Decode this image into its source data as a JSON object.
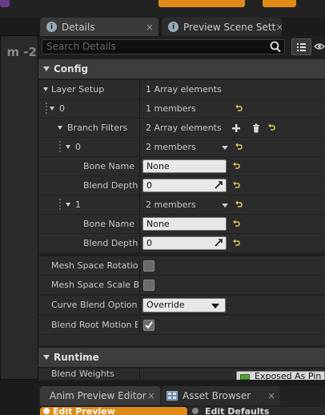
{
  "viewport_label": "m -2",
  "tabs": [
    {
      "label": "Details",
      "close": "×"
    },
    {
      "label": "Preview Scene Sett",
      "close": "×"
    }
  ],
  "search": {
    "placeholder": "Search Details"
  },
  "categories": {
    "config": "Config",
    "runtime": "Runtime"
  },
  "rows": {
    "layer_setup": {
      "label": "Layer Setup",
      "value": "1 Array elements"
    },
    "index0": {
      "label": "0",
      "value": "1 members"
    },
    "branch_filters": {
      "label": "Branch Filters",
      "value": "2 Array elements"
    },
    "bf0": {
      "label": "0",
      "value": "2 members"
    },
    "bf0_bone": {
      "label": "Bone Name",
      "value": "None"
    },
    "bf0_depth": {
      "label": "Blend Depth",
      "value": "0"
    },
    "bf1": {
      "label": "1",
      "value": "2 members"
    },
    "bf1_bone": {
      "label": "Bone Name",
      "value": "None"
    },
    "bf1_depth": {
      "label": "Blend Depth",
      "value": "0"
    },
    "mesh_rot": {
      "label": "Mesh Space Rotation"
    },
    "mesh_scale": {
      "label": "Mesh Space Scale Ble"
    },
    "curve_blend": {
      "label": "Curve Blend Option",
      "value": "Override"
    },
    "root_motion": {
      "label": "Blend Root Motion Ba"
    },
    "blend_weights": {
      "label": "Blend Weights",
      "value": "Exposed As Pin"
    }
  },
  "checkboxes": {
    "mesh_rot": false,
    "mesh_scale": false,
    "root_motion": true
  },
  "bottom_tabs": [
    {
      "label": "Anim Preview Editor",
      "close": "×"
    },
    {
      "label": "Asset Browser",
      "close": "×"
    }
  ],
  "bottom_sub": {
    "left": "Edit Preview",
    "right": "Edit Defaults"
  },
  "colors": {
    "accent_orange": "#e08a18",
    "reset_arrow": "#e0c060",
    "exposed_pin_green": "#5a9f3a"
  }
}
